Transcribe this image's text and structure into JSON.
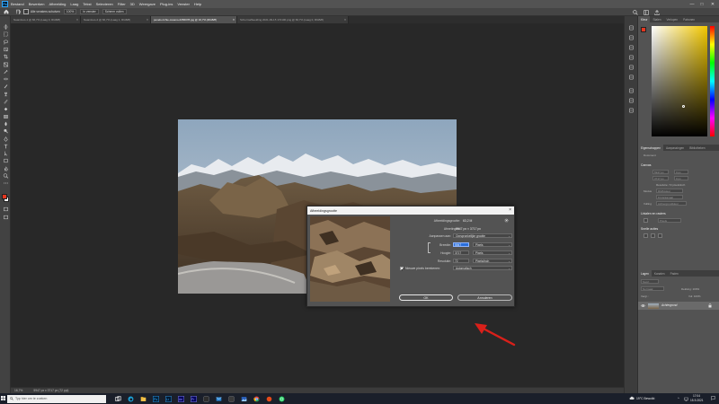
{
  "menubar": {
    "items": [
      "Bestand",
      "Bewerken",
      "Afbeelding",
      "Laag",
      "Tekst",
      "Selecteren",
      "Filter",
      "3D",
      "Weergave",
      "Plug-ins",
      "Venster",
      "Help"
    ],
    "minimize": "—",
    "maximize": "□",
    "close": "✕"
  },
  "options": {
    "all_windows": "Alle vensters schuiven",
    "zoom": "100%",
    "fit_screen": "In venster",
    "fill_screen": "Scherm vullen"
  },
  "tabs": [
    {
      "label": "Naamloos-1 @ 66,7% (Laag 0, RGB/8)",
      "active": false
    },
    {
      "label": "Naamloos-2 @ 66,7% (Laag 1, RGB/8)",
      "active": false
    },
    {
      "label": "pexels-richie-cusano-2356078.jpg @ 16,7% (RGB/8)",
      "active": true
    },
    {
      "label": "Schermafbeelding 2021-09-15 172100.png @ 66,7% (Laag 0, RGB/8)",
      "active": false
    }
  ],
  "statusbar": {
    "zoom": "16,7%",
    "dimensions": "5947 px x 3717 px (72 ppi)"
  },
  "panels": {
    "color_tabs": [
      "Kleur",
      "Stalen",
      "Verlopen",
      "Patronen"
    ],
    "properties_tabs": [
      "Eigenschappen",
      "Aanpassingen",
      "Bibliotheken"
    ],
    "document_label": "Document",
    "canvas_title": "Canvas",
    "canvas_fields": [
      "5947 px",
      "3717 px",
      "0 px",
      "0 px"
    ],
    "resolution": "Resolutie: 72 pixels/inch",
    "mode_label": "Modus",
    "mode_value": "RGB-kleur",
    "bitdepth": "8 bits/kanaal",
    "fill_label": "Vulling",
    "fill_value": "Achtergrondkleur",
    "rulers_title": "Linialen en rasters",
    "rulers_unit": "Pixels",
    "quick_actions_title": "Snelle acties",
    "layers_tabs": [
      "Lagen",
      "Kanalen",
      "Paden"
    ],
    "layers_kind": "Soort",
    "layers_blend": "Normaal",
    "layers_opacity": "Dekking: 100%",
    "layers_lock": "Vergr.:",
    "layers_fill": "Vul: 100%",
    "layer_name": "Achtergrond"
  },
  "dialog": {
    "title": "Afbeeldingsgrootte",
    "size_label": "Afbeeldingsgrootte:",
    "size_value": "63,2 M",
    "dims_label": "Afmetingen:",
    "dims_value": "5947 px  ×  3717 px",
    "fit_label": "Aanpassen aan:",
    "fit_value": "Oorspronkelijke grootte",
    "width_label": "Breedte:",
    "width_value": "5947",
    "width_unit": "Pixels",
    "height_label": "Hoogte:",
    "height_value": "3717",
    "height_unit": "Pixels",
    "res_label": "Resolutie:",
    "res_value": "72",
    "res_unit": "Pixels/inch",
    "resample_label": "Nieuwe pixels berekenen:",
    "resample_value": "Automatisch",
    "ok": "OK",
    "cancel": "Annuleren"
  },
  "taskbar": {
    "search_placeholder": "Typ hier om te zoeken",
    "weather": "19°C  Bewolkt",
    "time": "17:04",
    "date": "15-9-2021"
  },
  "colors": {
    "foreground": "#e4371f",
    "background": "#ffffff",
    "arrow": "#d9201a"
  }
}
